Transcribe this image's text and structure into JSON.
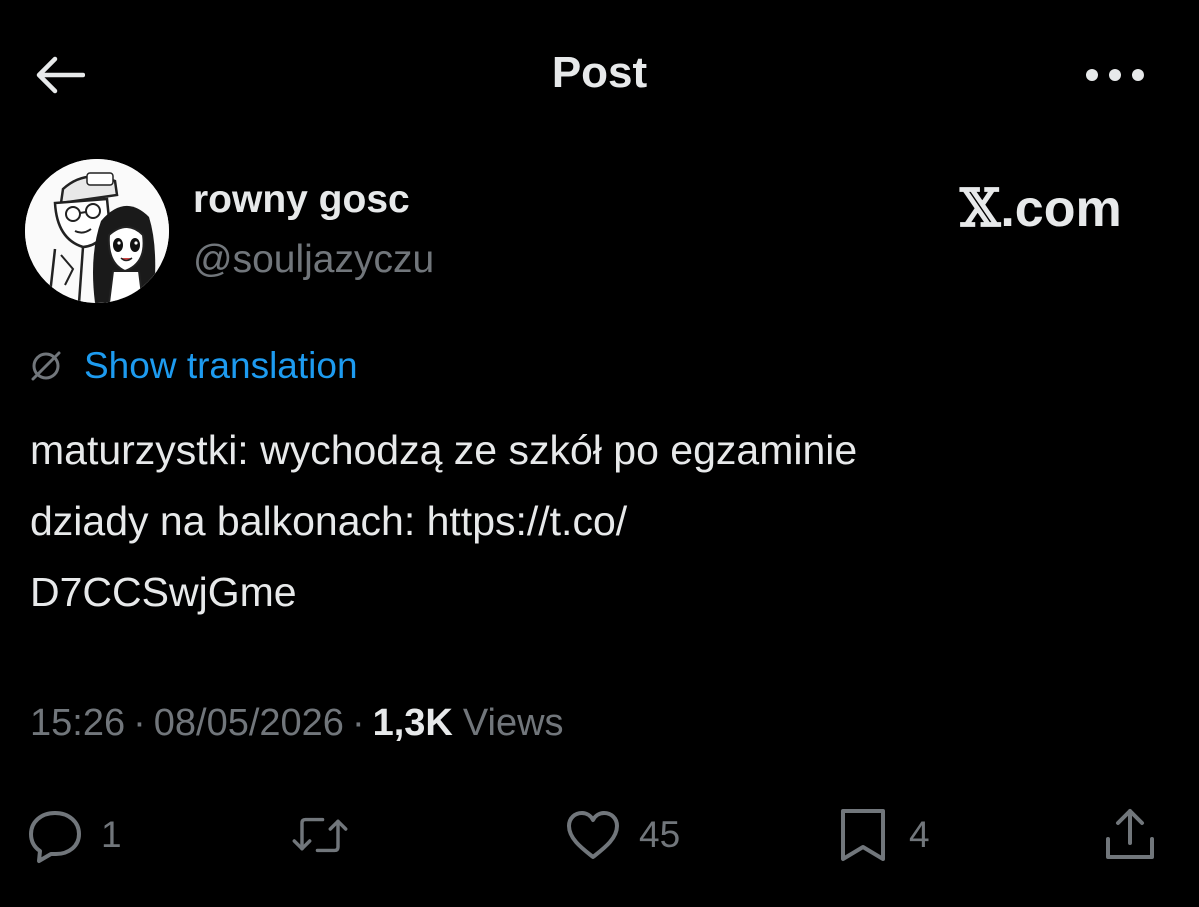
{
  "header": {
    "title": "Post",
    "back_icon": "arrow-left-icon",
    "more_icon": "more-horizontal-icon"
  },
  "author": {
    "display_name": "rowny gosc",
    "handle": "@souljazyczu"
  },
  "watermark": {
    "x": "𝕏",
    "rest": ".com"
  },
  "translation": {
    "label": "Show translation",
    "icon": "globe-icon"
  },
  "tweet": {
    "lines": [
      "maturzystki: wychodzą ze szkół po egzaminie",
      "dziady na balkonach: https://t.co/",
      "D7CCSwjGme"
    ]
  },
  "meta": {
    "time": "15:26",
    "date": "08/05/2026",
    "views_count": "1,3K",
    "views_label": "Views",
    "separator": "·"
  },
  "actions": {
    "replies": "1",
    "likes": "45",
    "bookmarks": "4"
  },
  "colors": {
    "background": "#000000",
    "text": "#e7e9ea",
    "muted": "#71767b",
    "link": "#1d9bf0"
  }
}
